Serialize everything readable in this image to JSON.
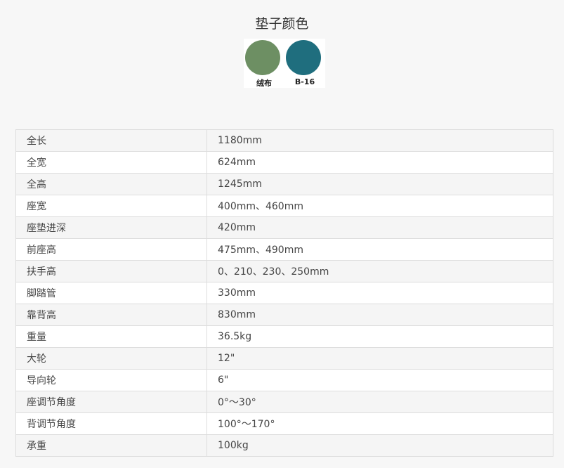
{
  "cushion": {
    "title": "垫子颜色",
    "swatches": [
      {
        "label": "绒布",
        "color": "#6d8f63"
      },
      {
        "label": "B-16",
        "color": "#1f6e7e"
      }
    ]
  },
  "specs": [
    {
      "label": "全长",
      "value": "1180mm"
    },
    {
      "label": "全宽",
      "value": "624mm"
    },
    {
      "label": "全高",
      "value": "1245mm"
    },
    {
      "label": "座宽",
      "value": "400mm、460mm"
    },
    {
      "label": "座垫进深",
      "value": "420mm"
    },
    {
      "label": "前座高",
      "value": "475mm、490mm"
    },
    {
      "label": "扶手高",
      "value": "0、210、230、250mm"
    },
    {
      "label": "脚踏管",
      "value": "330mm"
    },
    {
      "label": "靠背高",
      "value": "830mm"
    },
    {
      "label": "重量",
      "value": "36.5kg"
    },
    {
      "label": "大轮",
      "value": "12\""
    },
    {
      "label": "导向轮",
      "value": "6\""
    },
    {
      "label": "座调节角度",
      "value": "0°〜30°"
    },
    {
      "label": "背调节角度",
      "value": "100°〜170°"
    },
    {
      "label": "承重",
      "value": "100kg"
    }
  ]
}
